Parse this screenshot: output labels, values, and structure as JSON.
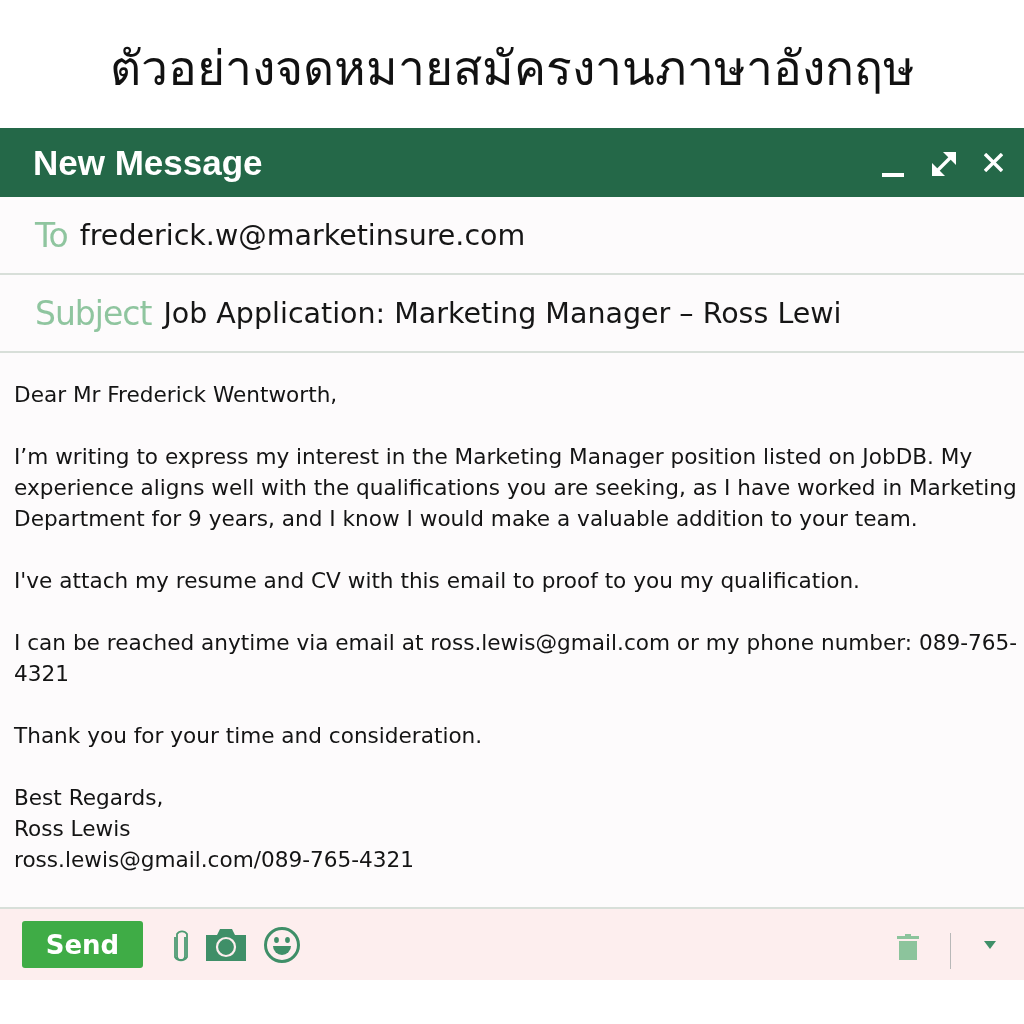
{
  "page_title": "ตัวอย่างจดหมายสมัครงานภาษาอังกฤษ",
  "window": {
    "title": "New Message"
  },
  "fields": [
    {
      "label": "To",
      "value": "frederick.w@marketinsure.com"
    },
    {
      "label": "Subject",
      "value": "Job Application: Marketing Manager – Ross Lewi"
    }
  ],
  "body": {
    "paragraphs": [
      [
        "Dear Mr Frederick Wentworth,"
      ],
      [
        "I’m writing to express my interest in the Marketing Manager position listed on JobDB. My experience aligns well with the qualifications you are seeking, as I have worked in Marketing Department for 9 years, and I know I would make a valuable addition to your team."
      ],
      [
        "I've attach my resume and CV with this email to proof to you my qualification."
      ],
      [
        "I can be reached anytime via email at ross.lewis@gmail.com or my phone number: 089-765-4321"
      ],
      [
        "Thank you for your time and consideration."
      ],
      [
        "Best Regards,",
        "Ross Lewis",
        "ross.lewis@gmail.com/089-765-4321"
      ]
    ]
  },
  "toolbar": {
    "send_label": "Send"
  }
}
